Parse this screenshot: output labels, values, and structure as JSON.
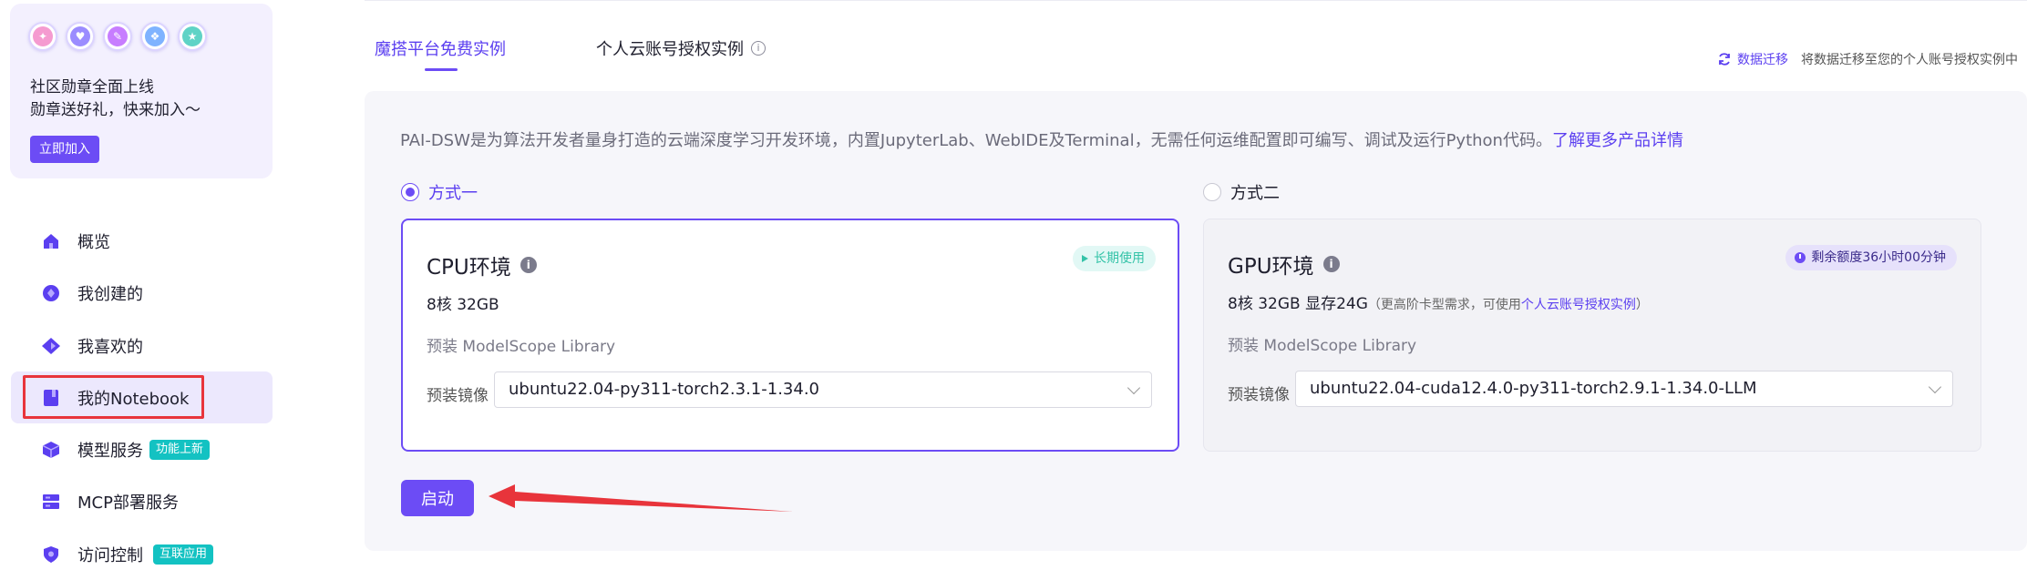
{
  "promo": {
    "line1": "社区勋章全面上线",
    "line2": "勋章送好礼，快来加入～",
    "join_label": "立即加入",
    "badge_icons": [
      "medal-badge-1",
      "medal-badge-2",
      "medal-badge-3",
      "medal-badge-4",
      "medal-badge-5"
    ]
  },
  "sidebar": {
    "items": [
      {
        "label": "概览",
        "icon": "home-icon"
      },
      {
        "label": "我创建的",
        "icon": "create-icon"
      },
      {
        "label": "我喜欢的",
        "icon": "favorite-icon"
      },
      {
        "label": "我的Notebook",
        "icon": "notebook-icon",
        "active": true
      },
      {
        "label": "模型服务",
        "icon": "model-service-icon",
        "tag": "功能上新"
      },
      {
        "label": "MCP部署服务",
        "icon": "mcp-server-icon"
      },
      {
        "label": "访问控制",
        "icon": "shield-icon",
        "tag": "互联应用"
      }
    ]
  },
  "tabs": {
    "active": "魔搭平台免费实例",
    "second": "个人云账号授权实例"
  },
  "migrate": {
    "link": "数据迁移",
    "desc": "将数据迁移至您的个人账号授权实例中"
  },
  "description": {
    "text": "PAI-DSW是为算法开发者量身打造的云端深度学习开发环境，内置JupyterLab、WebIDE及Terminal，无需任何运维配置即可编写、调试及运行Python代码。",
    "more_link": "了解更多产品详情"
  },
  "options": {
    "one": "方式一",
    "two": "方式二"
  },
  "cpu": {
    "title": "CPU环境",
    "spec": "8核 32GB",
    "badge": "长期使用",
    "lib": "预装 ModelScope Library",
    "mirror_label": "预装镜像",
    "mirror_value": "ubuntu22.04-py311-torch2.3.1-1.34.0"
  },
  "gpu": {
    "title": "GPU环境",
    "spec": "8核 32GB 显存24G",
    "note_prefix": "（更高阶卡型需求，可使用",
    "note_link": "个人云账号授权实例",
    "note_suffix": "）",
    "badge": "剩余额度36小时00分钟",
    "lib": "预装 ModelScope Library",
    "mirror_label": "预装镜像",
    "mirror_value": "ubuntu22.04-cuda12.4.0-py311-torch2.9.1-1.34.0-LLM"
  },
  "start_label": "启动",
  "colors": {
    "accent": "#6c4cf5",
    "tag_teal": "#13c2c2",
    "annotation_red": "#e8343b"
  }
}
